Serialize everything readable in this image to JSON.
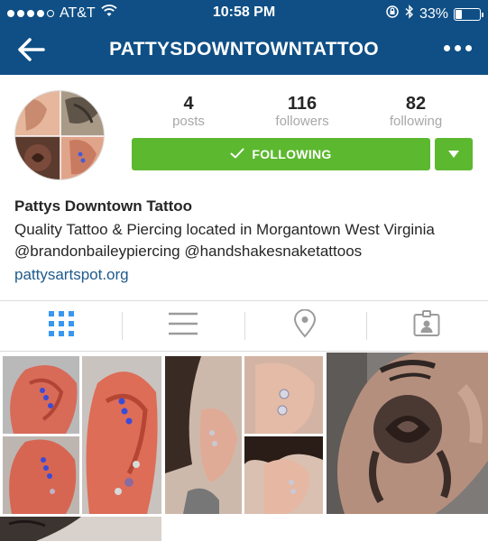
{
  "status_bar": {
    "carrier": "AT&T",
    "time": "10:58 PM",
    "battery": "33%",
    "battery_level": 0.33,
    "icons": [
      "signal-dots-icon",
      "wifi-icon",
      "rotation-lock-icon",
      "bluetooth-icon",
      "battery-icon"
    ]
  },
  "nav": {
    "title": "PATTYSDOWNTOWNTATTOO",
    "back_icon": "back-arrow-icon",
    "more_icon": "more-dots-icon"
  },
  "profile": {
    "stats": [
      {
        "count": "4",
        "label": "posts"
      },
      {
        "count": "116",
        "label": "followers"
      },
      {
        "count": "82",
        "label": "following"
      }
    ],
    "follow_button": "FOLLOWING",
    "follow_icon": "checkmark-icon",
    "dropdown_icon": "caret-down-icon",
    "accent_color": "#5cb82f"
  },
  "bio": {
    "name": "Pattys Downtown Tattoo",
    "text": "Quality Tattoo & Piercing located in Morgantown West Virginia @brandonbaileypiercing @handshakesnaketattoos",
    "link": "pattysartspot.org"
  },
  "tabs": [
    {
      "name": "grid-view",
      "icon": "grid-icon",
      "active": true
    },
    {
      "name": "list-view",
      "icon": "list-icon",
      "active": false
    },
    {
      "name": "places",
      "icon": "location-pin-icon",
      "active": false
    },
    {
      "name": "tagged",
      "icon": "tagged-person-icon",
      "active": false
    }
  ],
  "colors": {
    "header_blue": "#0f4f85",
    "active_tab": "#3897f0",
    "inactive_tab": "#9b9b9b",
    "link": "#1f5a8c"
  }
}
